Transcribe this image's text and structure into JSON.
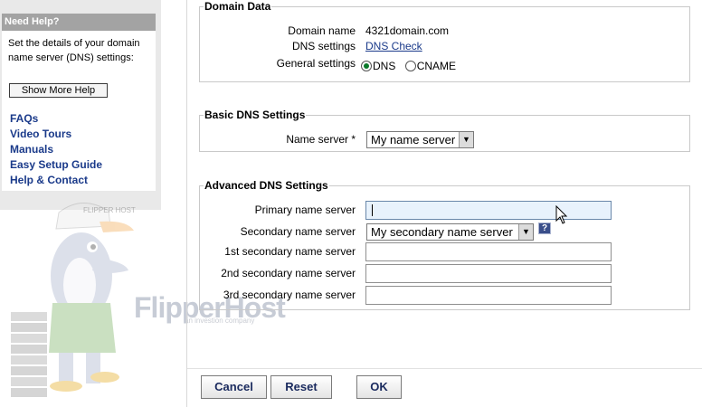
{
  "help": {
    "title": "Need Help?",
    "text": "Set the details of your domain name server (DNS) settings:",
    "show_more_label": "Show More Help",
    "links": [
      "FAQs",
      "Video Tours",
      "Manuals",
      "Easy Setup Guide",
      "Help & Contact"
    ]
  },
  "brand": {
    "logo": "FlipperHost",
    "tagline": "an investion company",
    "mascot_cap_text": "FLIPPER HOST"
  },
  "domain_data": {
    "legend": "Domain Data",
    "domain_name_label": "Domain name",
    "domain_name_value": "4321domain.com",
    "dns_settings_label": "DNS settings",
    "dns_settings_link": "DNS Check",
    "general_settings_label": "General settings",
    "general_options": [
      {
        "label": "DNS",
        "checked": true
      },
      {
        "label": "CNAME",
        "checked": false
      }
    ]
  },
  "basic_dns": {
    "legend": "Basic DNS Settings",
    "name_server_label": "Name server *",
    "name_server_value": "My name server"
  },
  "advanced_dns": {
    "legend": "Advanced DNS Settings",
    "primary_label": "Primary name server",
    "primary_value": "",
    "secondary_label": "Secondary name server",
    "secondary_value": "My secondary name server",
    "help_icon": "question-icon",
    "first_secondary_label": "1st secondary name server",
    "second_secondary_label": "2nd secondary name server",
    "third_secondary_label": "3rd secondary name server"
  },
  "actions": {
    "cancel_label": "Cancel",
    "reset_label": "Reset",
    "ok_label": "OK"
  },
  "colors": {
    "link": "#1a3a8a",
    "help_title_bg": "#a3a3a3",
    "focused_input_bg": "#e8f2fc"
  }
}
